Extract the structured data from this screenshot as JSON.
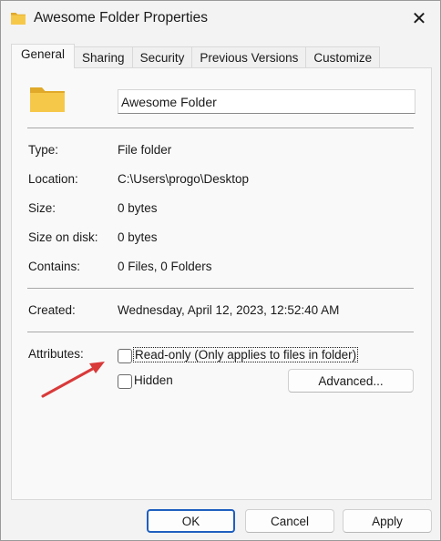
{
  "window": {
    "title": "Awesome Folder Properties",
    "close_glyph": "✕"
  },
  "icons": {
    "title": "folder-icon",
    "large": "folder-icon",
    "close": "close-icon",
    "annotation": "red-arrow"
  },
  "colors": {
    "folder_yellow": "#f6c84a",
    "folder_shade": "#e0a92a",
    "accent_blue": "#1f5fbf",
    "arrow_red": "#d93a3a"
  },
  "tabs": [
    {
      "label": "General",
      "active": true
    },
    {
      "label": "Sharing",
      "active": false
    },
    {
      "label": "Security",
      "active": false
    },
    {
      "label": "Previous Versions",
      "active": false
    },
    {
      "label": "Customize",
      "active": false
    }
  ],
  "folder_name": "Awesome Folder",
  "properties": {
    "type": {
      "label": "Type:",
      "value": "File folder"
    },
    "location": {
      "label": "Location:",
      "value": "C:\\Users\\progo\\Desktop"
    },
    "size": {
      "label": "Size:",
      "value": "0 bytes"
    },
    "size_on_disk": {
      "label": "Size on disk:",
      "value": "0 bytes"
    },
    "contains": {
      "label": "Contains:",
      "value": "0 Files, 0 Folders"
    },
    "created": {
      "label": "Created:",
      "value": "Wednesday, April 12, 2023, 12:52:40 AM"
    }
  },
  "attributes": {
    "label": "Attributes:",
    "readonly": {
      "label": "Read-only (Only applies to files in folder)",
      "checked": false
    },
    "hidden": {
      "label": "Hidden",
      "checked": false
    },
    "advanced_label": "Advanced..."
  },
  "buttons": {
    "ok": "OK",
    "cancel": "Cancel",
    "apply": "Apply"
  }
}
